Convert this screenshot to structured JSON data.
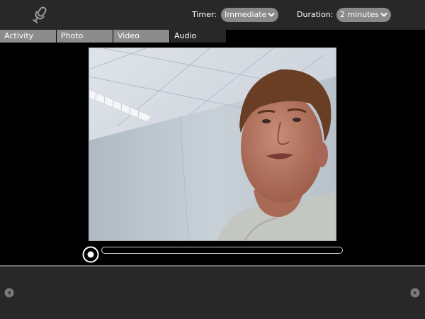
{
  "toolbar": {
    "icon": "microphone-icon",
    "timer_label": "Timer:",
    "timer_value": "Immediate",
    "duration_label": "Duration:",
    "duration_value": "2 minutes"
  },
  "tabs": [
    {
      "label": "Activity",
      "active": false
    },
    {
      "label": "Photo",
      "active": false
    },
    {
      "label": "Video",
      "active": false
    },
    {
      "label": "Audio",
      "active": true
    }
  ],
  "preview": {
    "content": "webcam-photo",
    "record_icon": "record-icon",
    "progress": 0
  },
  "tray": {
    "left_icon": "arrow-left-icon",
    "right_icon": "arrow-right-icon"
  },
  "colors": {
    "toolbar_bg": "#282828",
    "tab_bg": "#8c8c8c",
    "tab_active_bg": "#282828",
    "combo_bg": "#8a8a8a"
  }
}
